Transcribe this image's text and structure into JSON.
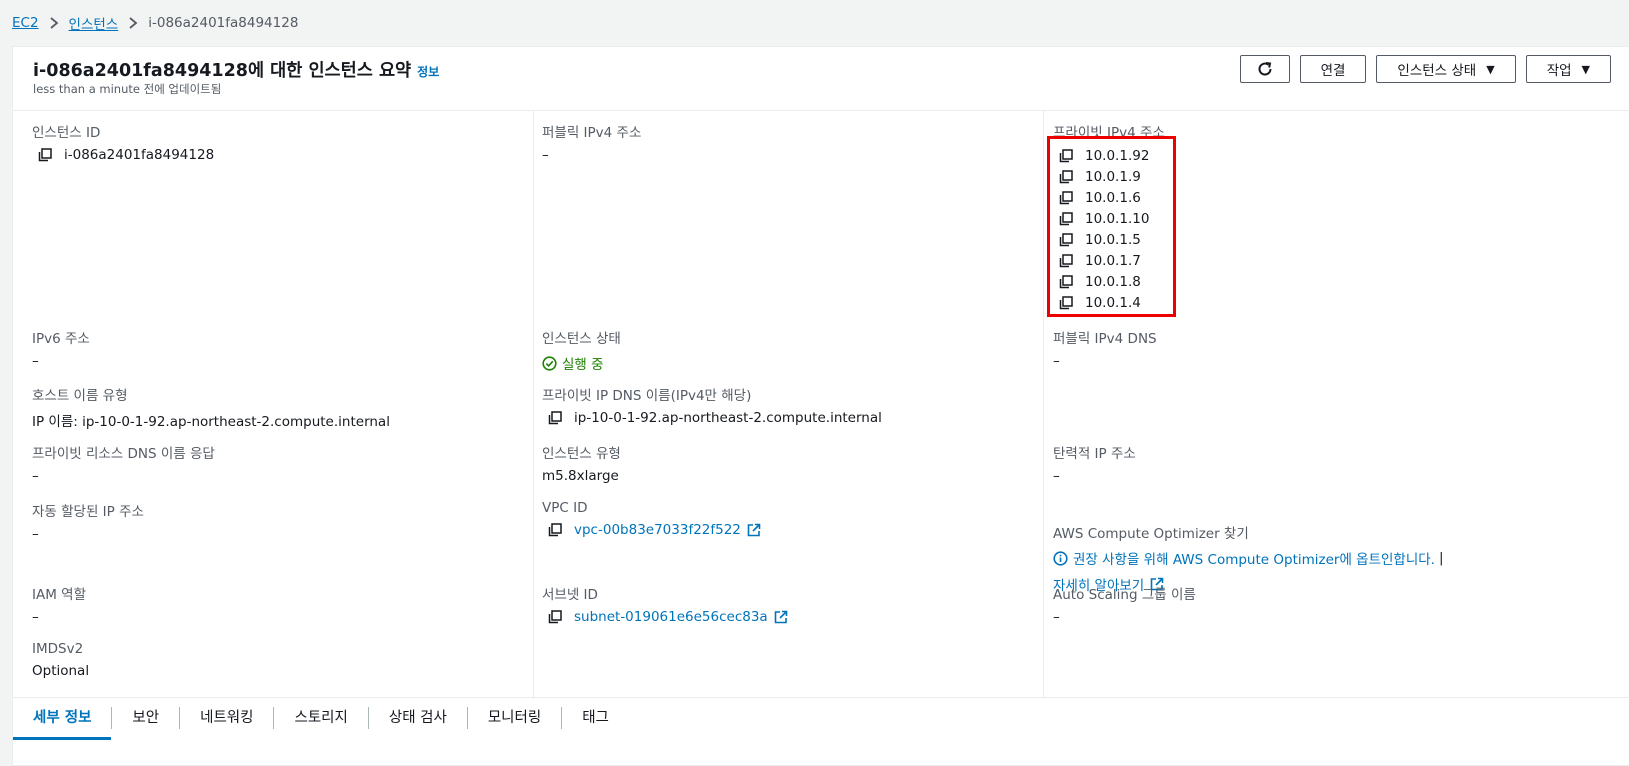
{
  "breadcrumb": {
    "items": [
      "EC2",
      "인스턴스"
    ],
    "current": "i-086a2401fa8494128"
  },
  "header": {
    "title": "i-086a2401fa8494128에 대한 인스턴스 요약",
    "info_link": "정보",
    "subtitle": "less than a minute 전에 업데이트됨"
  },
  "actions": {
    "refresh_icon": "refresh-icon",
    "connect": "연결",
    "instance_state": "인스턴스 상태",
    "actions": "작업"
  },
  "fields": {
    "instance_id": {
      "label": "인스턴스 ID",
      "value": "i-086a2401fa8494128"
    },
    "public_ipv4": {
      "label": "퍼블릭 IPv4 주소",
      "value": "–"
    },
    "private_ipv4": {
      "label": "프라이빗 IPv4 주소",
      "values": [
        "10.0.1.92",
        "10.0.1.9",
        "10.0.1.6",
        "10.0.1.10",
        "10.0.1.5",
        "10.0.1.7",
        "10.0.1.8",
        "10.0.1.4"
      ]
    },
    "ipv6": {
      "label": "IPv6 주소",
      "value": "–"
    },
    "instance_state": {
      "label": "인스턴스 상태",
      "value": "실행 중"
    },
    "public_dns": {
      "label": "퍼블릭 IPv4 DNS",
      "value": "–"
    },
    "hostname_type": {
      "label": "호스트 이름 유형",
      "value": "IP 이름: ip-10-0-1-92.ap-northeast-2.compute.internal"
    },
    "private_dns": {
      "label": "프라이빗 IP DNS 이름(IPv4만 해당)",
      "value": "ip-10-0-1-92.ap-northeast-2.compute.internal"
    },
    "private_resource_dns": {
      "label": "프라이빗 리소스 DNS 이름 응답",
      "value": "–"
    },
    "instance_type": {
      "label": "인스턴스 유형",
      "value": "m5.8xlarge"
    },
    "elastic_ip": {
      "label": "탄력적 IP 주소",
      "value": "–"
    },
    "auto_ip": {
      "label": "자동 할당된 IP 주소",
      "value": "–"
    },
    "vpc_id": {
      "label": "VPC ID",
      "value": "vpc-00b83e7033f22f522"
    },
    "optimizer": {
      "label": "AWS Compute Optimizer 찾기",
      "optin_text": "권장 사항을 위해 AWS Compute Optimizer에 옵트인합니다.",
      "pipe": "|",
      "learn_more": "자세히 알아보기"
    },
    "iam_role": {
      "label": "IAM 역할",
      "value": "–"
    },
    "subnet_id": {
      "label": "서브넷 ID",
      "value": "subnet-019061e6e56cec83a"
    },
    "asg_name": {
      "label": "Auto Scaling 그룹 이름",
      "value": "–"
    },
    "imdsv2": {
      "label": "IMDSv2",
      "value": "Optional"
    }
  },
  "tabs": [
    {
      "label": "세부 정보",
      "active": true
    },
    {
      "label": "보안"
    },
    {
      "label": "네트워킹"
    },
    {
      "label": "스토리지"
    },
    {
      "label": "상태 검사"
    },
    {
      "label": "모니터링"
    },
    {
      "label": "태그"
    }
  ],
  "colors": {
    "link": "#0073bb",
    "success": "#1d8102",
    "highlight": "#ee0000"
  }
}
